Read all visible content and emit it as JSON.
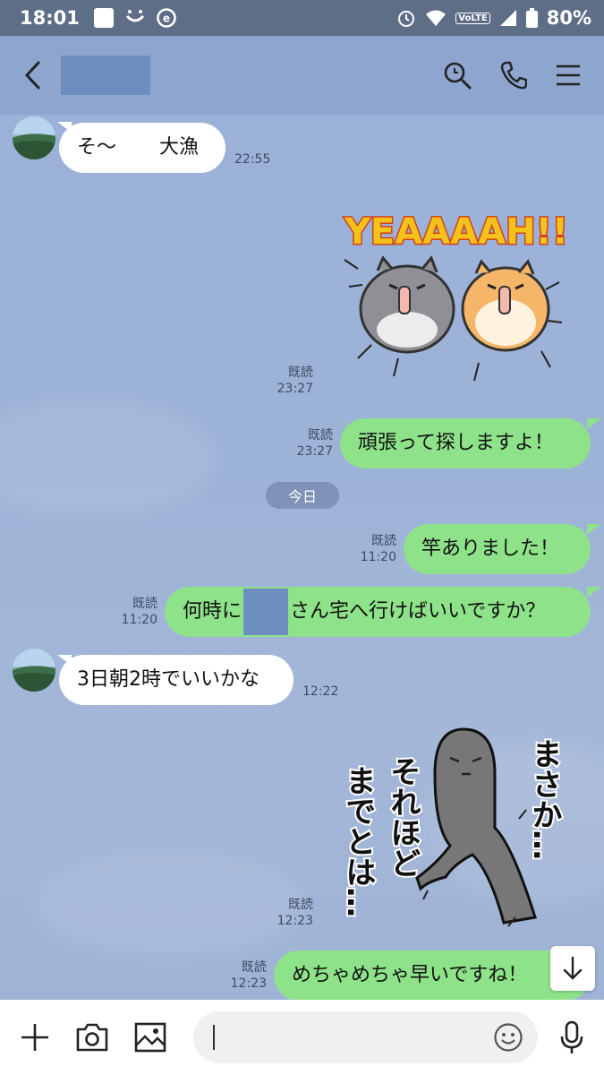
{
  "status_bar": {
    "time": "18:01",
    "network": "VoLTE",
    "battery": "80%"
  },
  "header": {
    "back_icon": "chevron-left-icon",
    "search_icon": "search-icon",
    "call_icon": "phone-icon",
    "menu_icon": "menu-icon"
  },
  "messages": [
    {
      "side": "in",
      "text_a": "そ〜",
      "text_b": "大漁",
      "time": "22:55"
    },
    {
      "side": "out",
      "type": "sticker",
      "sticker_text": "YEAAAAH!!",
      "read": "既読",
      "time": "23:27"
    },
    {
      "side": "out",
      "text": "頑張って探しますよ！",
      "read": "既読",
      "time": "23:27"
    },
    {
      "side": "out",
      "text": "竿ありました！",
      "read": "既読",
      "time": "11:20"
    },
    {
      "side": "out",
      "text_a": "何時に",
      "text_b": "さん宅へ行けばいいですか？",
      "read": "既読",
      "time": "11:20"
    },
    {
      "side": "in",
      "text": "3日朝2時でいいかな",
      "time": "12:22"
    },
    {
      "side": "out",
      "type": "sticker",
      "sticker_text_a": "それほど",
      "sticker_text_b": "までとは…",
      "sticker_text_c": "まさか…",
      "read": "既読",
      "time": "12:23"
    },
    {
      "side": "out",
      "text": "めちゃめちゃ早いですね！",
      "read": "既読",
      "time": "12:23"
    }
  ],
  "day_separator": "今日",
  "input": {
    "placeholder": ""
  },
  "colors": {
    "chat_bg": "#9cb1d8",
    "outgoing": "#8ee38a",
    "incoming": "#ffffff",
    "status_bar": "#5f6e87"
  }
}
